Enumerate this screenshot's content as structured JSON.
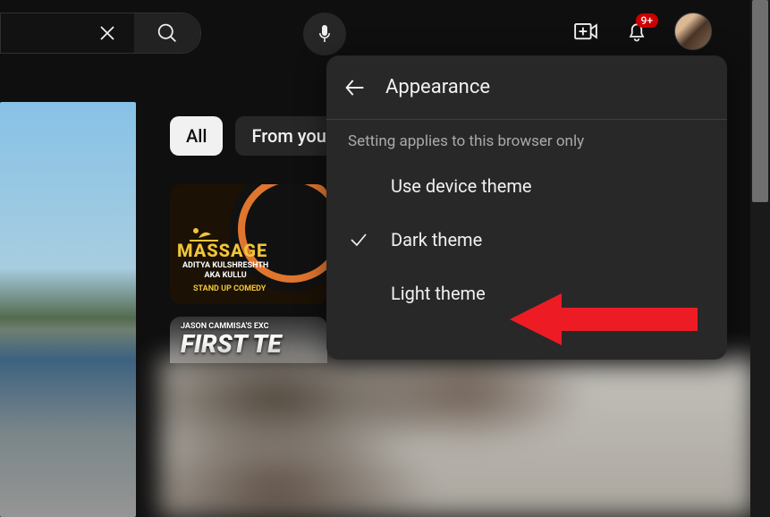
{
  "header": {
    "notif_badge": "9+"
  },
  "chips": {
    "all": "All",
    "from_you": "From you"
  },
  "thumb1": {
    "title": "MASSAGE",
    "subtitle_line1": "ADITYA KULSHRESHTH",
    "subtitle_line2": "AKA KULLU",
    "tagline": "STAND UP COMEDY"
  },
  "thumb2": {
    "subtitle": "JASON CAMMISA'S EXC",
    "title": "FIRST TE"
  },
  "popup": {
    "title": "Appearance",
    "hint": "Setting applies to this browser only",
    "options": [
      {
        "label": "Use device theme",
        "checked": false
      },
      {
        "label": "Dark theme",
        "checked": true
      },
      {
        "label": "Light theme",
        "checked": false
      }
    ]
  }
}
